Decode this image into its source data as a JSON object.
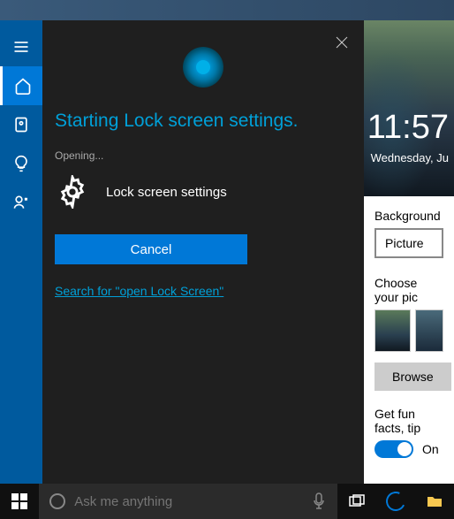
{
  "cortana": {
    "title": "Starting Lock screen settings.",
    "opening": "Opening...",
    "item_label": "Lock screen settings",
    "cancel": "Cancel",
    "search_link": "Search for \"open Lock Screen\""
  },
  "lock_preview": {
    "time": "11:57",
    "date": "Wednesday, Ju"
  },
  "settings": {
    "bg_label": "Background",
    "bg_value": "Picture",
    "choose_label": "Choose your pic",
    "browse": "Browse",
    "funfacts_label": "Get fun facts, tip",
    "toggle_label": "On"
  },
  "search": {
    "placeholder": "Ask me anything"
  }
}
